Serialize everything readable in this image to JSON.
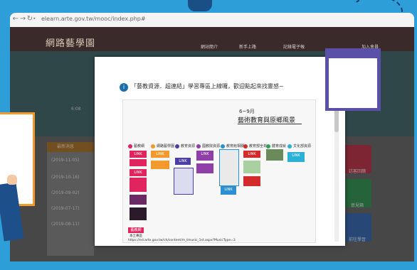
{
  "browser": {
    "url": "elearn.arte.gov.tw/mooc/index.php#",
    "back_icon": "back-arrow-icon",
    "forward_icon": "forward-arrow-icon",
    "reload_icon": "reload-icon"
  },
  "site": {
    "logo": "網路藝學園",
    "nav": [
      "網站簡介",
      "新手上路",
      "記錄電子報",
      "加入會員"
    ],
    "news_header": "最新消息",
    "news_dates": [
      "(2019-11-05)",
      "(2019-10-16)",
      "(2019-09-02)",
      "(2019-07-17)",
      "(2019-08-11)"
    ],
    "side_tiles": [
      "訪客回饋",
      "意見箱",
      "前往學習"
    ],
    "video_time": "6:08"
  },
  "modal": {
    "message": "「藝教資源．超連結」學習專區上線囉，歡迎點起來找靈感~",
    "poster_date": "6~9月",
    "poster_title": "藝術教育與原鄉風景",
    "categories": [
      "藝教網",
      "網路藝學園",
      "教育資源",
      "國教院資源",
      "教育館相關",
      "教育部全年",
      "體育成就",
      "文化部資源"
    ],
    "link_label": "LINK",
    "footer_tag": "藝教網",
    "footer_sub": "本土專區",
    "footer_url": "https://ed.arte.gov.tw/ch/content/m_tmusic_1st.aspx?MusicType=3"
  },
  "colors": {
    "frame": "#2d9ed8",
    "accent_orange": "#f29a2e",
    "purple": "#5b50a8",
    "link_pink": "#e0245e"
  }
}
